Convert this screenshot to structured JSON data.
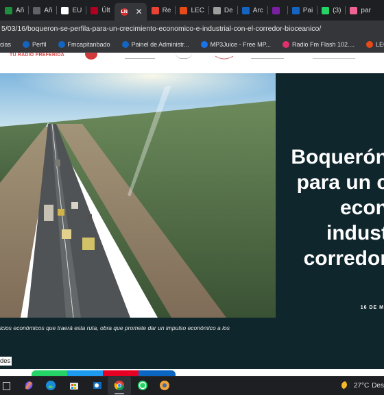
{
  "browser": {
    "tabs": [
      {
        "label": "Añ",
        "icon": "sheet-icon",
        "color": "#1e8e3e"
      },
      {
        "label": "Añ",
        "icon": "dash-icon",
        "color": "#5f6368"
      },
      {
        "label": "EU",
        "icon": "news-icon",
        "color": "#ffffff"
      },
      {
        "label": "Últ",
        "icon": "news-icon",
        "color": "#b00020"
      },
      {
        "label": "",
        "icon": "site-icon",
        "color": "#d32f2f",
        "active": true
      },
      {
        "label": "Re",
        "icon": "gmail-icon",
        "color": "#ea4335"
      },
      {
        "label": "LEC",
        "icon": "leo-icon",
        "color": "#e64a19"
      },
      {
        "label": "De",
        "icon": "globe-icon",
        "color": "#9e9e9e"
      },
      {
        "label": "Arc",
        "icon": "cloud-icon",
        "color": "#1565c0"
      },
      {
        "label": "",
        "icon": "audio-icon",
        "color": "#7b1fa2"
      },
      {
        "label": "Pai",
        "icon": "cloud-icon",
        "color": "#1565c0"
      },
      {
        "label": "(3)",
        "icon": "whatsapp-icon",
        "color": "#25d366"
      },
      {
        "label": "par",
        "icon": "wave-icon",
        "color": "#f06292"
      }
    ],
    "url": "5/03/16/boqueron-se-perfila-para-un-crecimiento-economico-e-industrial-con-el-corredor-bioceanico/",
    "bookmarks": [
      {
        "label": "cias",
        "color": "transparent"
      },
      {
        "label": "Perfil",
        "color": "#1565c0"
      },
      {
        "label": "Fmcapitanbado",
        "color": "#1565c0"
      },
      {
        "label": "Painel de Administr...",
        "color": "#1565c0"
      },
      {
        "label": "MP3Juice - Free MP...",
        "color": "#1a73e8"
      },
      {
        "label": "Radio Fm Flash 102....",
        "color": "#e1306c"
      },
      {
        "label": "LEOlytics | Exclusive...",
        "color": "#e64a19"
      }
    ]
  },
  "page": {
    "radio_slogan": "TU RADIO PREFERIDA",
    "headline": "Boquerón\npara un c\necon\nindust\ncorredor",
    "date": "16 DE M",
    "caption": "icios económicos que traerá esta ruta, obra que promete dar un impulso económico a los",
    "below_text": "des"
  },
  "taskbar": {
    "weather": {
      "temperature": "27°C",
      "label": "Des"
    }
  }
}
